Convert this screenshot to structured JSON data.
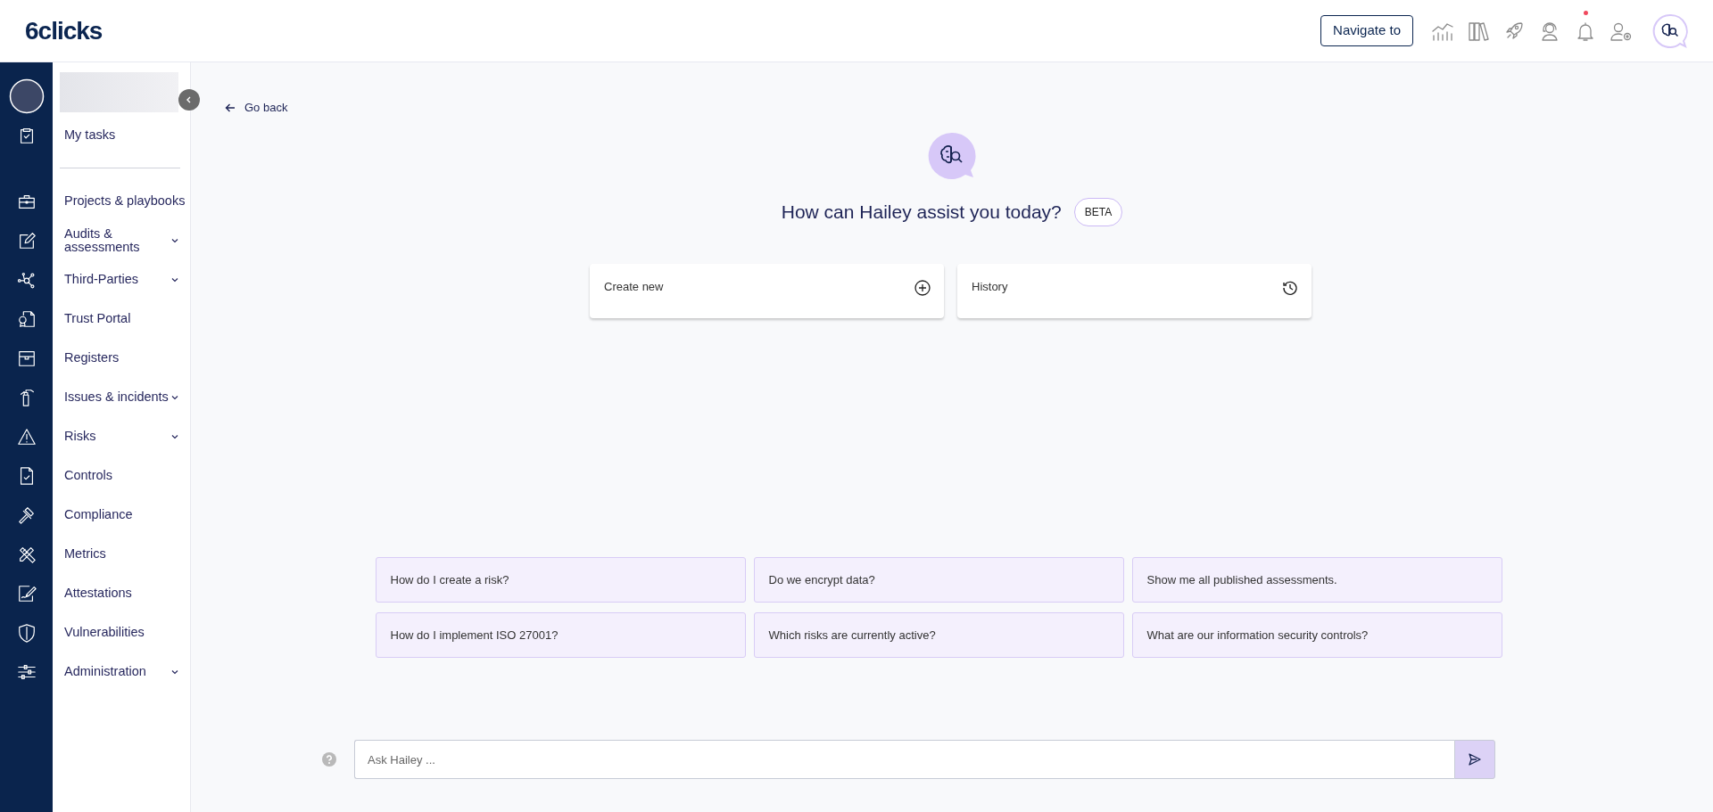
{
  "header": {
    "logo": "6clicks",
    "navigate_button": "Navigate to",
    "notifications": {
      "unread": true
    }
  },
  "sidebar": {
    "groups": [
      {
        "items": [
          {
            "label": "My tasks",
            "expandable": false
          }
        ]
      },
      {
        "items": [
          {
            "label": "Projects & playbooks",
            "expandable": false
          },
          {
            "label": "Audits & assessments",
            "expandable": true
          },
          {
            "label": "Third-Parties",
            "expandable": true
          },
          {
            "label": "Trust Portal",
            "expandable": false
          },
          {
            "label": "Registers",
            "expandable": false
          },
          {
            "label": "Issues & incidents",
            "expandable": true
          },
          {
            "label": "Risks",
            "expandable": true
          },
          {
            "label": "Controls",
            "expandable": false
          },
          {
            "label": "Compliance",
            "expandable": false
          },
          {
            "label": "Metrics",
            "expandable": false
          },
          {
            "label": "Attestations",
            "expandable": false
          },
          {
            "label": "Vulnerabilities",
            "expandable": false
          },
          {
            "label": "Administration",
            "expandable": true
          }
        ]
      }
    ]
  },
  "main": {
    "back_link": "Go back",
    "heading": "How can Hailey assist you today?",
    "badge": "BETA",
    "actions": [
      {
        "label": "Create new",
        "kind": "create"
      },
      {
        "label": "History",
        "kind": "history"
      }
    ],
    "suggestions": [
      "How do I create a risk?",
      "Do we encrypt data?",
      "Show me all published assessments.",
      "How do I implement ISO 27001?",
      "Which risks are currently active?",
      "What are our information security controls?"
    ],
    "input": {
      "placeholder": "Ask Hailey ..."
    }
  }
}
